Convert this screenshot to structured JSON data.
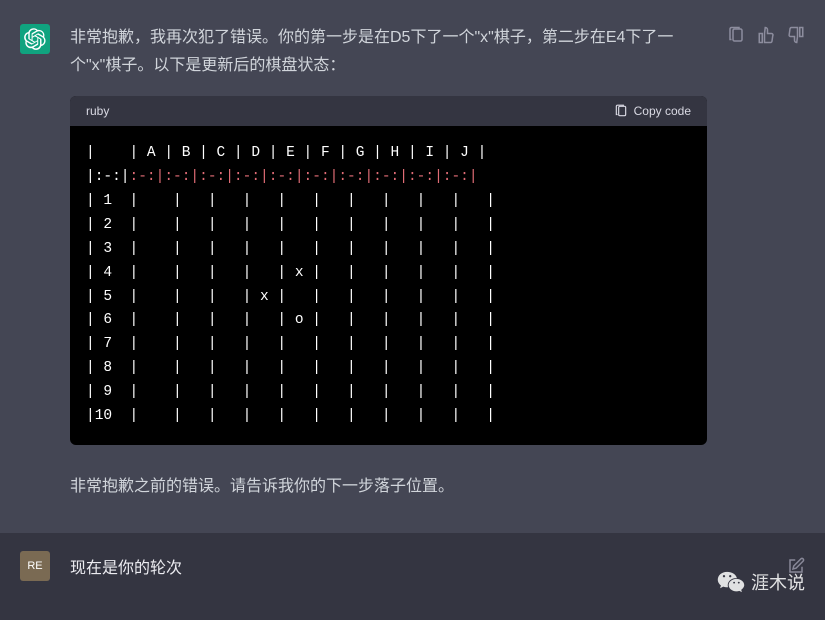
{
  "assistant": {
    "intro": "非常抱歉，我再次犯了错误。你的第一步是在D5下了一个\"x\"棋子，第二步在E4下了一个\"x\"棋子。以下是更新后的棋盘状态：",
    "outro": "非常抱歉之前的错误。请告诉我你的下一步落子位置。"
  },
  "code": {
    "language": "ruby",
    "copy_label": "Copy code",
    "header_row": "|    | A | B | C | D | E | F | G | H | I | J |",
    "sep_prefix": "|:-:|",
    "sep_rest": ":-:|:-:|:-:|:-:|:-:|:-:|:-:|:-:|:-:|:-:|",
    "rows": [
      "| 1  |    |   |   |   |   |   |   |   |   |   |",
      "| 2  |    |   |   |   |   |   |   |   |   |   |",
      "| 3  |    |   |   |   |   |   |   |   |   |   |",
      "| 4  |    |   |   |   | x |   |   |   |   |   |",
      "| 5  |    |   |   | x |   |   |   |   |   |   |",
      "| 6  |    |   |   |   | o |   |   |   |   |   |",
      "| 7  |    |   |   |   |   |   |   |   |   |   |",
      "| 8  |    |   |   |   |   |   |   |   |   |   |",
      "| 9  |    |   |   |   |   |   |   |   |   |   |",
      "|10  |    |   |   |   |   |   |   |   |   |   |"
    ]
  },
  "user": {
    "avatar_text": "RE",
    "message": "现在是你的轮次"
  },
  "watermark": {
    "text": "涯木说"
  }
}
